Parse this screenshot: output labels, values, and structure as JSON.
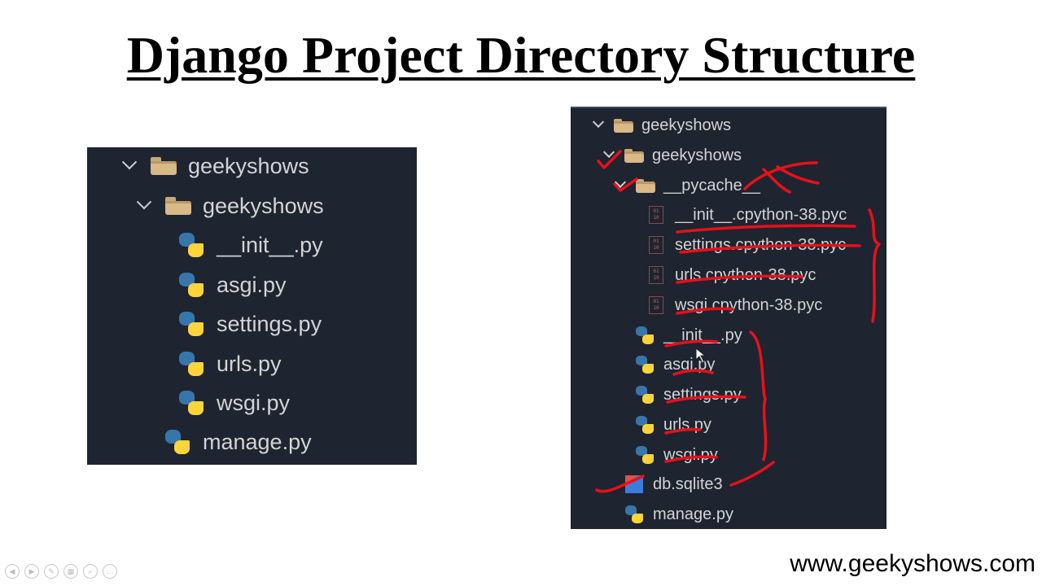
{
  "slide": {
    "title": "Django Project Directory Structure",
    "website": "www.geekyshows.com"
  },
  "left_tree": {
    "root": "geekyshows",
    "app_folder": "geekyshows",
    "app_files": [
      "__init__.py",
      "asgi.py",
      "settings.py",
      "urls.py",
      "wsgi.py"
    ],
    "root_file": "manage.py"
  },
  "right_tree": {
    "root": "geekyshows",
    "app_folder": "geekyshows",
    "cache_folder": "__pycache__",
    "cache_files": [
      "__init__.cpython-38.pyc",
      "settings.cpython-38.pyc",
      "urls.cpython-38.pyc",
      "wsgi.cpython-38.pyc"
    ],
    "app_files": [
      "__init__.py",
      "asgi.py",
      "settings.py",
      "urls.py",
      "wsgi.py"
    ],
    "root_files": [
      "db.sqlite3",
      "manage.py"
    ]
  },
  "colors": {
    "panel_bg": "#1e2430",
    "annotation_red": "#e8101a"
  },
  "icons": [
    "chevron-down-icon",
    "folder-icon",
    "python-file-icon",
    "pyc-file-icon",
    "database-icon"
  ]
}
